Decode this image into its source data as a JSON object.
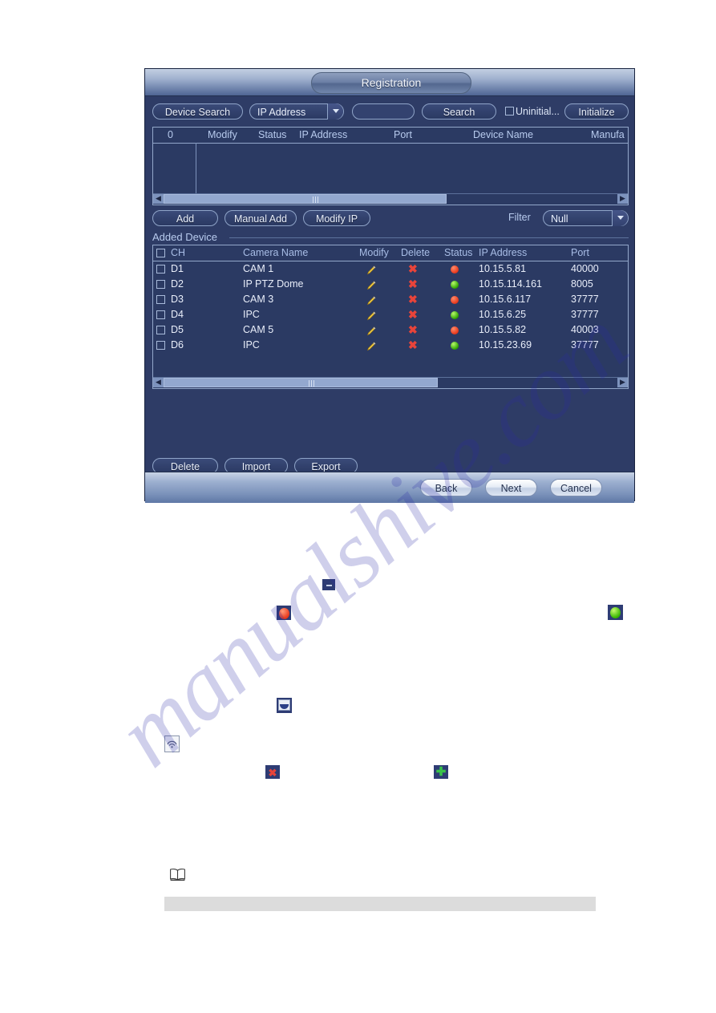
{
  "watermark": {
    "text": "manualshive.com"
  },
  "dialog": {
    "title": "Registration",
    "search_bar": {
      "device_search_label": "Device Search",
      "search_type_value": "IP Address",
      "search_input_value": "",
      "search_button_label": "Search",
      "uninitialized_checkbox_label": "Uninitial...",
      "uninitialized_checked": false,
      "initialize_button_label": "Initialize"
    },
    "search_table": {
      "count": "0",
      "columns": [
        "Modify",
        "Status",
        "IP Address",
        "Port",
        "Device Name",
        "Manufa"
      ],
      "rows": []
    },
    "toolbar": {
      "add_label": "Add",
      "manual_add_label": "Manual Add",
      "modify_ip_label": "Modify IP",
      "filter_label": "Filter",
      "filter_value": "Null"
    },
    "added_device": {
      "legend": "Added Device",
      "columns": [
        "CH",
        "Camera Name",
        "Modify",
        "Delete",
        "Status",
        "IP Address",
        "Port"
      ],
      "rows": [
        {
          "ch": "D1",
          "camera_name": "CAM 1",
          "status": "red",
          "ip_address": "10.15.5.81",
          "port": "40000",
          "checked": false
        },
        {
          "ch": "D2",
          "camera_name": "IP PTZ Dome",
          "status": "green",
          "ip_address": "10.15.114.161",
          "port": "8005",
          "checked": false
        },
        {
          "ch": "D3",
          "camera_name": "CAM 3",
          "status": "red",
          "ip_address": "10.15.6.117",
          "port": "37777",
          "checked": false
        },
        {
          "ch": "D4",
          "camera_name": "IPC",
          "status": "green",
          "ip_address": "10.15.6.25",
          "port": "37777",
          "checked": false
        },
        {
          "ch": "D5",
          "camera_name": "CAM 5",
          "status": "red",
          "ip_address": "10.15.5.82",
          "port": "40003",
          "checked": false
        },
        {
          "ch": "D6",
          "camera_name": "IPC",
          "status": "green",
          "ip_address": "10.15.23.69",
          "port": "37777",
          "checked": false
        }
      ]
    },
    "list_actions": {
      "delete_label": "Delete",
      "import_label": "Import",
      "export_label": "Export"
    },
    "footer": {
      "back_label": "Back",
      "next_label": "Next",
      "cancel_label": "Cancel"
    }
  },
  "inline_icons": [
    {
      "name": "minus-icon"
    },
    {
      "name": "status-red-icon"
    },
    {
      "name": "status-green-icon"
    },
    {
      "name": "camera-icon"
    },
    {
      "name": "wifi-signal-icon"
    },
    {
      "name": "delete-x-icon"
    },
    {
      "name": "add-plus-icon"
    },
    {
      "name": "note-book-icon"
    }
  ],
  "colors": {
    "dialog_bg": "#2e3c66",
    "panel_border": "#93a7ca",
    "header_text": "#b8cbee",
    "status_red": "#e8371a",
    "status_green": "#2ea400",
    "delete_x": "#e8443a",
    "pencil": "#f0d24a",
    "gray_bar": "#dcdcdc"
  }
}
